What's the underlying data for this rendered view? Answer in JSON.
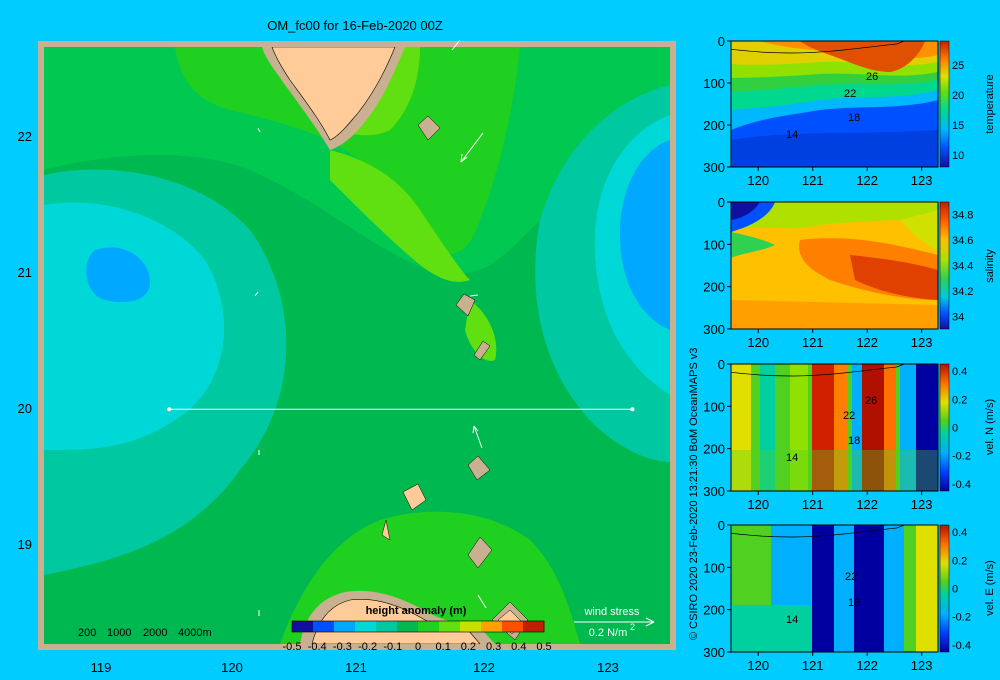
{
  "chart_data": [
    {
      "type": "heatmap",
      "title": "OM_fc00 for 16-Feb-2020 00Z",
      "x_ticks": [
        "119",
        "120",
        "121",
        "122",
        "123"
      ],
      "y_ticks": [
        "19",
        "20",
        "21",
        "22"
      ],
      "xlim": [
        118.5,
        123.5
      ],
      "ylim": [
        18.25,
        22.7
      ],
      "colorbar_label": "height anomaly (m)",
      "colorbar_ticks": [
        "-0.5",
        "-0.4",
        "-0.3",
        "-0.2",
        "-0.1",
        "0",
        "0.1",
        "0.2",
        "0.3",
        "0.4",
        "0.5"
      ],
      "colorbar_range": [
        -0.5,
        0.5
      ],
      "colors": [
        "#1010a0",
        "#0050ff",
        "#00a8ff",
        "#00d8d8",
        "#00c8a0",
        "#00b850",
        "#20d020",
        "#60e010",
        "#c8e000",
        "#ffa000",
        "#ff5000",
        "#c02000"
      ],
      "bathymetry_legend": [
        "200",
        "1000",
        "2000",
        "4000m"
      ],
      "wind_stress_label": "wind stress",
      "wind_stress_scale": "0.2 N/m",
      "wind_stress_exponent": "2",
      "section_line": {
        "lon": [
          119.5,
          123.2
        ],
        "lat": [
          20.0,
          20.0
        ]
      }
    },
    {
      "type": "heatmap",
      "variable": "temperature",
      "x_ticks": [
        "120",
        "121",
        "122",
        "123"
      ],
      "y_ticks": [
        "0",
        "100",
        "200",
        "300"
      ],
      "xlim": [
        119.5,
        123.3
      ],
      "ylim": [
        300,
        0
      ],
      "colorbar_ticks": [
        "10",
        "15",
        "20",
        "25"
      ],
      "colorbar_range": [
        8,
        29
      ],
      "contour_labels": [
        "26",
        "22",
        "18",
        "14"
      ]
    },
    {
      "type": "heatmap",
      "variable": "salinity",
      "x_ticks": [
        "120",
        "121",
        "122",
        "123"
      ],
      "y_ticks": [
        "0",
        "100",
        "200",
        "300"
      ],
      "xlim": [
        119.5,
        123.3
      ],
      "ylim": [
        300,
        0
      ],
      "colorbar_ticks": [
        "34",
        "34.2",
        "34.4",
        "34.6",
        "34.8"
      ],
      "colorbar_range": [
        33.9,
        34.9
      ]
    },
    {
      "type": "heatmap",
      "variable": "vel. N (m/s)",
      "x_ticks": [
        "120",
        "121",
        "122",
        "123"
      ],
      "y_ticks": [
        "0",
        "100",
        "200",
        "300"
      ],
      "xlim": [
        119.5,
        123.3
      ],
      "ylim": [
        300,
        0
      ],
      "colorbar_ticks": [
        "-0.4",
        "-0.2",
        "0",
        "0.2",
        "0.4"
      ],
      "colorbar_range": [
        -0.45,
        0.45
      ],
      "contour_labels": [
        "26",
        "22",
        "18",
        "14"
      ]
    },
    {
      "type": "heatmap",
      "variable": "vel. E (m/s)",
      "x_ticks": [
        "120",
        "121",
        "122",
        "123"
      ],
      "y_ticks": [
        "0",
        "100",
        "200",
        "300"
      ],
      "xlim": [
        119.5,
        123.3
      ],
      "ylim": [
        300,
        0
      ],
      "colorbar_ticks": [
        "-0.4",
        "-0.2",
        "0",
        "0.2",
        "0.4"
      ],
      "colorbar_range": [
        -0.45,
        0.45
      ],
      "contour_labels": [
        "22",
        "18",
        "14"
      ]
    }
  ],
  "credit": "© CSIRO 2020  23-Feb-2020 13:21:30 BoM OceanMAPS v3",
  "palette": {
    "background": "#00ccff",
    "land": "#ffcc99",
    "shelf": "#c8b090",
    "frame": "#c8b090"
  }
}
